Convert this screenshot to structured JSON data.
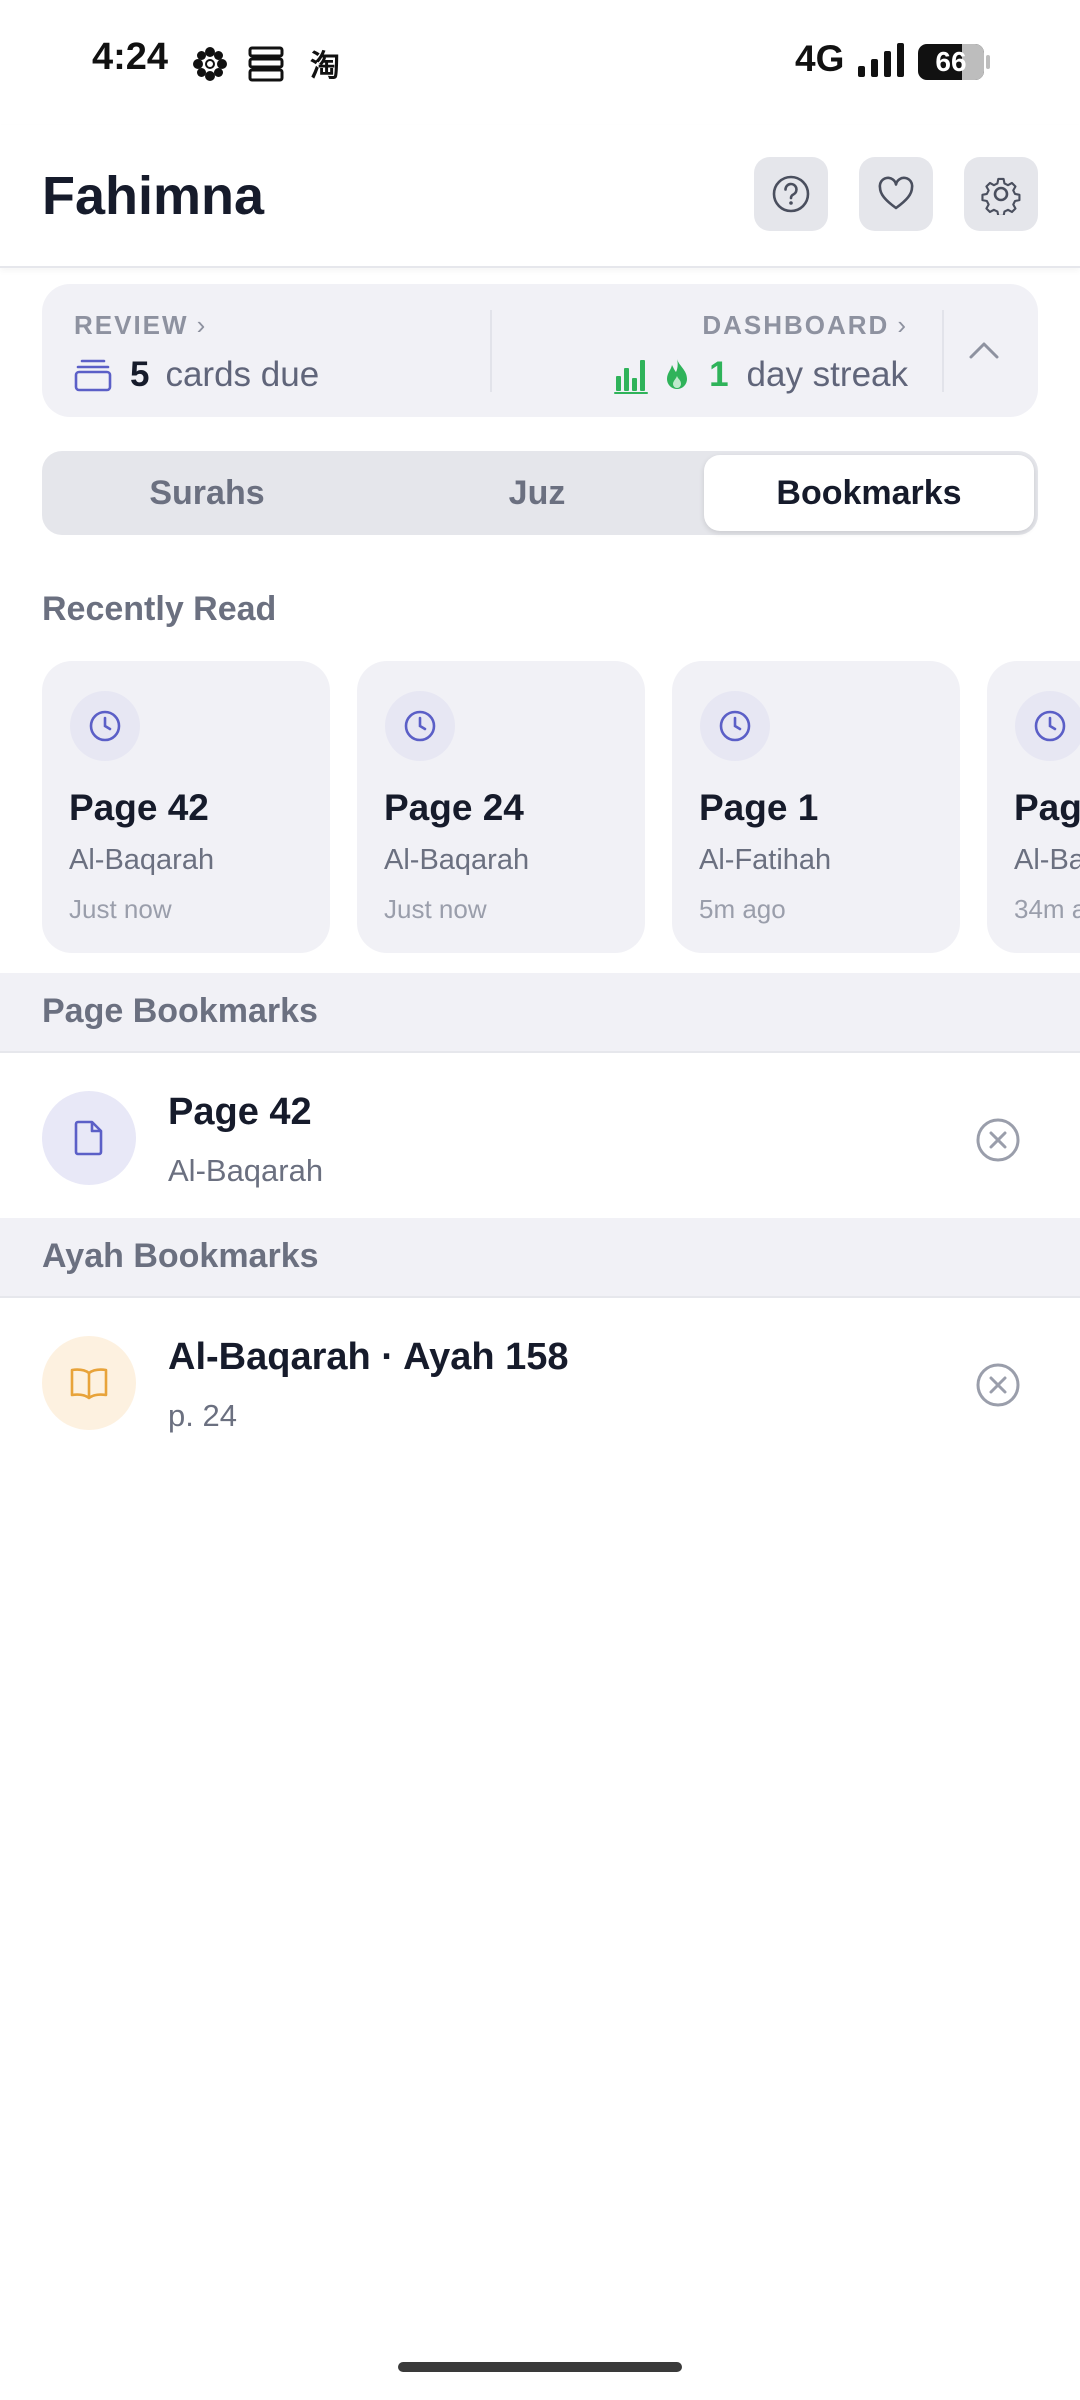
{
  "status_bar": {
    "time": "4:24",
    "network": "4G",
    "battery": "66",
    "notification_icons": [
      "flower-icon",
      "stack-icon",
      "taobao-icon"
    ]
  },
  "header": {
    "title": "Fahimna",
    "buttons": [
      "help-icon",
      "heart-icon",
      "gear-icon"
    ]
  },
  "stats": {
    "review_label": "REVIEW",
    "cards_due_count": "5",
    "cards_due_text": "cards due",
    "dashboard_label": "DASHBOARD",
    "streak_count": "1",
    "streak_text": "day streak",
    "accent_color": "#5b5fc7",
    "streak_color": "#2fb35a"
  },
  "tabs": {
    "items": [
      {
        "label": "Surahs"
      },
      {
        "label": "Juz"
      },
      {
        "label": "Bookmarks"
      }
    ],
    "active": "Bookmarks"
  },
  "recently_read": {
    "title": "Recently Read",
    "cards": [
      {
        "page": "Page 42",
        "surah": "Al-Baqarah",
        "time": "Just now"
      },
      {
        "page": "Page 24",
        "surah": "Al-Baqarah",
        "time": "Just now"
      },
      {
        "page": "Page 1",
        "surah": "Al-Fatihah",
        "time": "5m ago"
      },
      {
        "page": "Pag",
        "surah": "Al-Ba",
        "time": "34m a"
      }
    ]
  },
  "page_bookmarks": {
    "title": "Page Bookmarks",
    "items": [
      {
        "title": "Page 42",
        "subtitle": "Al-Baqarah"
      }
    ]
  },
  "ayah_bookmarks": {
    "title": "Ayah Bookmarks",
    "items": [
      {
        "title": "Al-Baqarah · Ayah 158",
        "subtitle": "p. 24"
      }
    ]
  }
}
